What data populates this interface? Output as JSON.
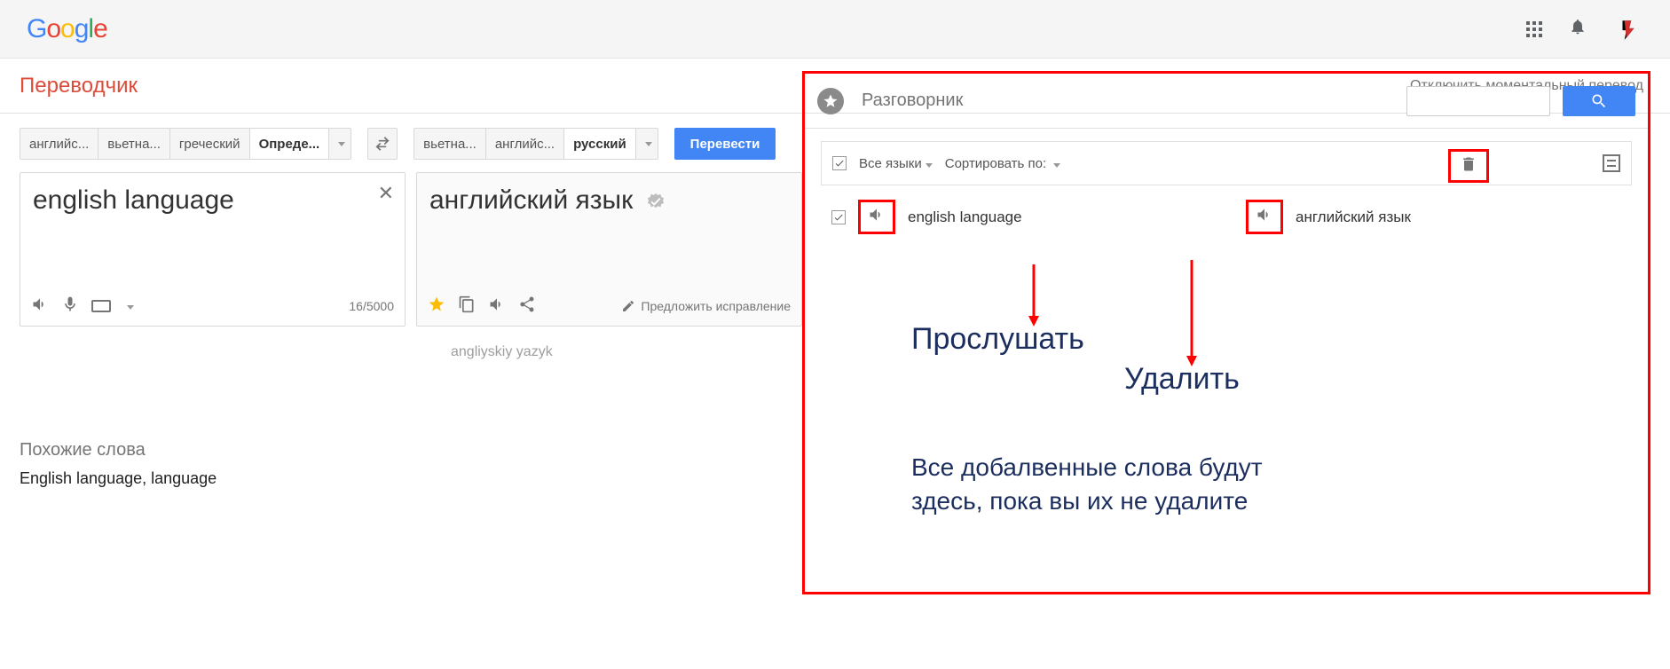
{
  "header": {
    "logo_letters": [
      "G",
      "o",
      "o",
      "g",
      "l",
      "e"
    ]
  },
  "titlebar": {
    "app_title": "Переводчик",
    "instant_off": "Отключить моментальный перевод"
  },
  "source_tabs": {
    "items": [
      "английс...",
      "вьетна...",
      "греческий",
      "Опреде..."
    ],
    "active_index": 3
  },
  "target_tabs": {
    "items": [
      "вьетна...",
      "английс...",
      "русский"
    ],
    "active_index": 2
  },
  "buttons": {
    "translate": "Перевести",
    "suggest_edit": "Предложить исправление"
  },
  "source": {
    "text": "english language",
    "char_count": "16/5000"
  },
  "target": {
    "text": "английский язык",
    "transliteration": "angliyskiy yazyk"
  },
  "similar": {
    "title": "Похожие слова",
    "words": "English language, language"
  },
  "phrasebook": {
    "title": "Разговорник",
    "toolbar": {
      "all_langs": "Все языки",
      "sort_by": "Сортировать по:"
    },
    "row": {
      "source": "english language",
      "target": "английский язык"
    }
  },
  "annotations": {
    "listen": "Прослушать",
    "delete": "Удалить",
    "paragraph": "Все добалвенные слова будут здесь, пока вы их не удалите"
  }
}
